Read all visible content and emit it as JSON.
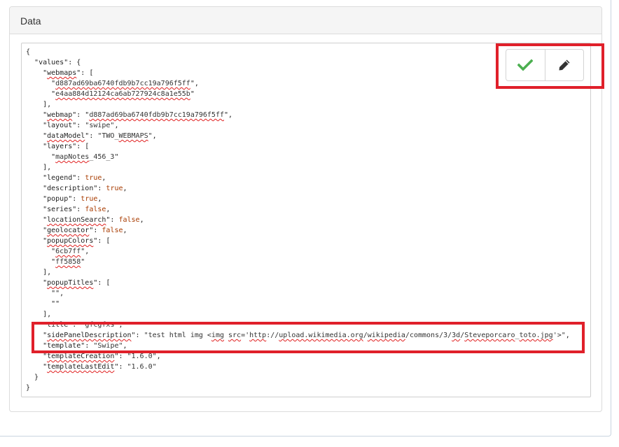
{
  "panel": {
    "title": "Data"
  },
  "toolbar": {
    "confirm_icon": "checkmark-icon",
    "edit_icon": "pencil-icon",
    "confirm_color": "#4caf50",
    "edit_color": "#333333"
  },
  "highlight_color": "#e0202a",
  "json_lines": [
    [
      [
        "p",
        "{"
      ]
    ],
    [
      [
        "p",
        "  "
      ],
      [
        "k",
        "\"values\""
      ],
      [
        "p",
        ": {"
      ]
    ],
    [
      [
        "p",
        "    \""
      ],
      [
        "ks",
        "webmaps"
      ],
      [
        "p",
        "\": ["
      ]
    ],
    [
      [
        "p",
        "      \""
      ],
      [
        "ss",
        "d887ad69ba6740fdb9b7cc19a796f5ff"
      ],
      [
        "p",
        "\","
      ]
    ],
    [
      [
        "p",
        "      \""
      ],
      [
        "ss",
        "e4aa884d12124ca6ab727924c8a1e55b"
      ],
      [
        "p",
        "\""
      ]
    ],
    [
      [
        "p",
        "    ],"
      ]
    ],
    [
      [
        "p",
        "    \""
      ],
      [
        "ks",
        "webmap"
      ],
      [
        "p",
        "\": \""
      ],
      [
        "ss",
        "d887ad69ba6740fdb9b7cc19a796f5ff"
      ],
      [
        "p",
        "\","
      ]
    ],
    [
      [
        "p",
        "    "
      ],
      [
        "k",
        "\"layout\""
      ],
      [
        "p",
        ": "
      ],
      [
        "s",
        "\"swipe\""
      ],
      [
        "p",
        ","
      ]
    ],
    [
      [
        "p",
        "    \""
      ],
      [
        "ks",
        "dataModel"
      ],
      [
        "p",
        "\": "
      ],
      [
        "s",
        "\"TWO_"
      ],
      [
        "ss",
        "WEBMAPS"
      ],
      [
        "s",
        "\""
      ],
      [
        "p",
        ","
      ]
    ],
    [
      [
        "p",
        "    "
      ],
      [
        "k",
        "\"layers\""
      ],
      [
        "p",
        ": ["
      ]
    ],
    [
      [
        "p",
        "      \""
      ],
      [
        "ss",
        "mapNotes"
      ],
      [
        "s",
        "_456_3"
      ],
      [
        "p",
        "\""
      ]
    ],
    [
      [
        "p",
        "    ],"
      ]
    ],
    [
      [
        "p",
        "    "
      ],
      [
        "k",
        "\"legend\""
      ],
      [
        "p",
        ": "
      ],
      [
        "b",
        "true"
      ],
      [
        "p",
        ","
      ]
    ],
    [
      [
        "p",
        "    "
      ],
      [
        "k",
        "\"description\""
      ],
      [
        "p",
        ": "
      ],
      [
        "b",
        "true"
      ],
      [
        "p",
        ","
      ]
    ],
    [
      [
        "p",
        "    "
      ],
      [
        "k",
        "\"popup\""
      ],
      [
        "p",
        ": "
      ],
      [
        "b",
        "true"
      ],
      [
        "p",
        ","
      ]
    ],
    [
      [
        "p",
        "    "
      ],
      [
        "k",
        "\"series\""
      ],
      [
        "p",
        ": "
      ],
      [
        "b",
        "false"
      ],
      [
        "p",
        ","
      ]
    ],
    [
      [
        "p",
        "    \""
      ],
      [
        "ks",
        "locationSearch"
      ],
      [
        "p",
        "\": "
      ],
      [
        "b",
        "false"
      ],
      [
        "p",
        ","
      ]
    ],
    [
      [
        "p",
        "    \""
      ],
      [
        "ks",
        "geolocator"
      ],
      [
        "p",
        "\": "
      ],
      [
        "b",
        "false"
      ],
      [
        "p",
        ","
      ]
    ],
    [
      [
        "p",
        "    \""
      ],
      [
        "ks",
        "popupColors"
      ],
      [
        "p",
        "\": ["
      ]
    ],
    [
      [
        "p",
        "      \""
      ],
      [
        "ss",
        "6cb7ff"
      ],
      [
        "p",
        "\","
      ]
    ],
    [
      [
        "p",
        "      \""
      ],
      [
        "ss",
        "ff5858"
      ],
      [
        "p",
        "\""
      ]
    ],
    [
      [
        "p",
        "    ],"
      ]
    ],
    [
      [
        "p",
        "    \""
      ],
      [
        "ks",
        "popupTitles"
      ],
      [
        "p",
        "\": ["
      ]
    ],
    [
      [
        "p",
        "      \"\","
      ]
    ],
    [
      [
        "p",
        "      \"\""
      ]
    ],
    [
      [
        "p",
        "    ],"
      ]
    ],
    [
      [
        "p",
        "    "
      ],
      [
        "k",
        "\"title\""
      ],
      [
        "p",
        ": "
      ],
      [
        "s",
        "\"gfcgfxs\""
      ],
      [
        "p",
        ","
      ]
    ],
    [
      [
        "p",
        "    \""
      ],
      [
        "ks",
        "sidePanelDescription"
      ],
      [
        "p",
        "\": "
      ],
      [
        "s",
        "\"test html img <"
      ],
      [
        "ss",
        "img"
      ],
      [
        "s",
        " "
      ],
      [
        "ss",
        "src"
      ],
      [
        "s",
        "='"
      ],
      [
        "ss",
        "http"
      ],
      [
        "s",
        "://"
      ],
      [
        "ss",
        "upload.wikimedia.org"
      ],
      [
        "s",
        "/"
      ],
      [
        "ss",
        "wikipedia"
      ],
      [
        "s",
        "/commons/3/"
      ],
      [
        "ss",
        "3d"
      ],
      [
        "s",
        "/"
      ],
      [
        "ss",
        "Steveporcaro"
      ],
      [
        "s",
        "_"
      ],
      [
        "ss",
        "toto.jpg"
      ],
      [
        "s",
        "'>\""
      ],
      [
        "p",
        ","
      ]
    ],
    [
      [
        "p",
        "    "
      ],
      [
        "k",
        "\"template\""
      ],
      [
        "p",
        ": "
      ],
      [
        "s",
        "\"Swipe\""
      ],
      [
        "p",
        ","
      ]
    ],
    [
      [
        "p",
        "    \""
      ],
      [
        "ks",
        "templateCreation"
      ],
      [
        "p",
        "\": "
      ],
      [
        "s",
        "\"1.6.0\""
      ],
      [
        "p",
        ","
      ]
    ],
    [
      [
        "p",
        "    \""
      ],
      [
        "ks",
        "templateLastEdit"
      ],
      [
        "p",
        "\": "
      ],
      [
        "s",
        "\"1.6.0\""
      ]
    ],
    [
      [
        "p",
        "  }"
      ]
    ],
    [
      [
        "p",
        "}"
      ]
    ]
  ]
}
